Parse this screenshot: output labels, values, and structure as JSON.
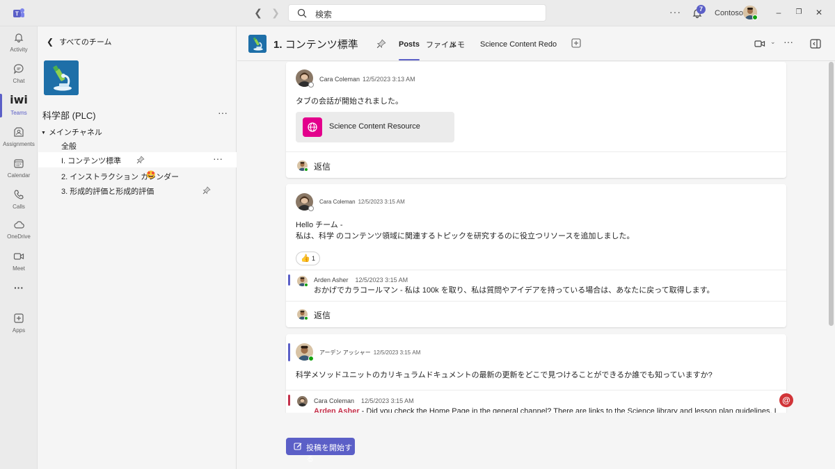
{
  "app": {
    "logo_icon": "teams-logo-icon"
  },
  "titlebar": {
    "search_placeholder": "検索",
    "more_label": "···",
    "notification_count": "7",
    "tenant": "Contoso"
  },
  "rail": {
    "items": [
      {
        "label": "Activity",
        "icon": "bell-icon"
      },
      {
        "label": "Chat",
        "icon": "chat-icon"
      },
      {
        "label": "Teams",
        "icon": "teams-icon",
        "glyph": "iwi"
      },
      {
        "label": "Assignments",
        "icon": "assignments-icon"
      },
      {
        "label": "Calendar",
        "icon": "calendar-icon"
      },
      {
        "label": "Calls",
        "icon": "phone-icon"
      },
      {
        "label": "OneDrive",
        "icon": "cloud-icon"
      },
      {
        "label": "Meet",
        "icon": "video-icon"
      },
      {
        "label": "···",
        "icon": "more-icon"
      },
      {
        "label": "Apps",
        "icon": "apps-icon"
      }
    ]
  },
  "panel": {
    "back_label": "すべてのチーム",
    "team_name": "科学部 (PLC)",
    "more": "···",
    "section_label": "メインチャネル",
    "channels": [
      {
        "label": "全般"
      },
      {
        "label": "I. コンテンツ標準"
      },
      {
        "label": "2. インストラクション カレンダー"
      },
      {
        "label": "3. 形成的評価と形成的評価"
      }
    ]
  },
  "header": {
    "channel_title_num": "1.",
    "channel_title_text": "コンテンツ標準",
    "tabs": [
      "Posts",
      "ファイル",
      "メモ",
      "Science Content Redo"
    ],
    "more": "···"
  },
  "posts": [
    {
      "author": "Cara Coleman",
      "time": "12/5/2023 3:13 AM",
      "body": "タブの会話が開始されました。",
      "link_title": "Science Content Resource",
      "reply_label": "返信"
    },
    {
      "author": "Cara Coleman",
      "time": "12/5/2023 3:15 AM",
      "body_line1": "Hello チーム -",
      "body_line2": "私は、科学 のコンテンツ領域に関連するトピックを研究するのに役立つリソースを追加しました。",
      "reaction_emoji": "👍",
      "reaction_count": "1",
      "reply": {
        "author": "Arden Asher",
        "time": "12/5/2023 3:15 AM",
        "body": "おかげでカラコールマン - 私は 100k を取り、私は質問やアイデアを持っている場合は、あなたに戻って取得します。"
      },
      "reply_label": "返信"
    },
    {
      "author": "アーデン アッシャー",
      "time": "12/5/2023 3:15 AM",
      "body": "科学メソッドユニットのカリキュラムドキュメントの最新の更新をどこで見つけることができるか誰でも知っていますか?",
      "reply": {
        "author": "Cara Coleman",
        "time": "12/5/2023 3:15 AM",
        "mention": "Arden Asher",
        "body": " - Did you check the Home Page in the general channel? There are links to the Science library and lesson plan guidelines. I"
      }
    }
  ],
  "new_post_label": "投稿を開始する",
  "colors": {
    "brand": "#5b5fc7",
    "mention": "#c4314b",
    "link_icon": "#e3008c"
  }
}
